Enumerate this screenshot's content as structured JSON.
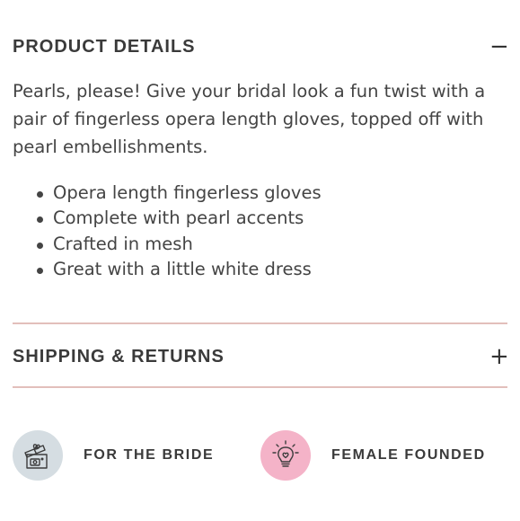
{
  "details": {
    "title": "PRODUCT DETAILS",
    "toggle": "−",
    "expanded": true,
    "description": "Pearls, please! Give your bridal look a fun twist with a pair of fingerless opera length gloves, topped off with pearl embellishments.",
    "bullets": [
      "Opera length fingerless gloves",
      "Complete with pearl accents",
      "Crafted in mesh",
      "Great with a little white dress"
    ]
  },
  "shipping": {
    "title": "SHIPPING & RETURNS",
    "toggle": "+",
    "expanded": false
  },
  "features": [
    {
      "label": "FOR THE BRIDE",
      "icon": "gift-box-icon",
      "color": "#d5dde2"
    },
    {
      "label": "FEMALE FOUNDED",
      "icon": "lightbulb-heart-icon",
      "color": "#f4b3c8"
    }
  ],
  "colors": {
    "divider": "#e2bfbb",
    "text": "#3e3e3e"
  }
}
